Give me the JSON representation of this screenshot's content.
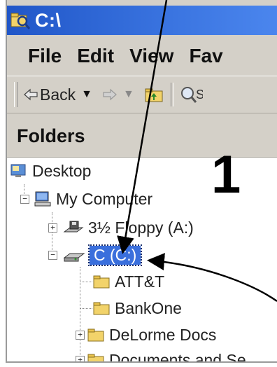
{
  "window": {
    "title": "C:\\"
  },
  "menu": {
    "items": [
      "File",
      "Edit",
      "View",
      "Fav"
    ]
  },
  "toolbar": {
    "back_label": "Back"
  },
  "folders_pane": {
    "title": "Folders"
  },
  "tree": {
    "desktop": "Desktop",
    "my_computer": "My Computer",
    "floppy": "3½ Floppy (A:)",
    "c_drive": "C (C:)",
    "folders": [
      "ATT&T",
      "BankOne",
      "DeLorme Docs",
      "Documents and Se"
    ]
  },
  "annotation": {
    "number": "1"
  },
  "colors": {
    "titlebar": "#2a62d8",
    "selection": "#3a6fdc",
    "folder": "#f2d36a"
  },
  "icons": [
    "explorer-icon",
    "back-arrow-icon",
    "forward-arrow-icon",
    "up-folder-icon",
    "search-icon",
    "desktop-icon",
    "computer-icon",
    "floppy-icon",
    "drive-icon",
    "folder-icon"
  ]
}
